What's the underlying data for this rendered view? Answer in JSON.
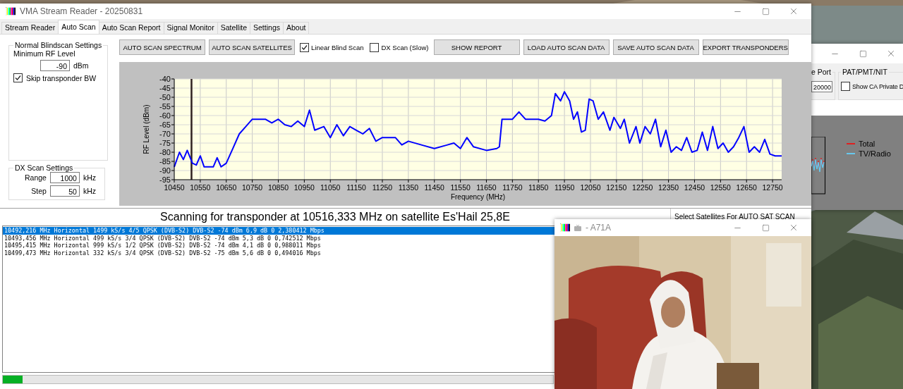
{
  "main_window": {
    "title": "VMA Stream Reader - 20250831",
    "tabs": [
      {
        "label": "Stream Reader",
        "selected": false
      },
      {
        "label": "Auto Scan",
        "selected": true
      },
      {
        "label": "Auto Scan Report",
        "selected": false
      },
      {
        "label": "Signal Monitor",
        "selected": false
      },
      {
        "label": "Satellite",
        "selected": false
      },
      {
        "label": "Settings",
        "selected": false
      },
      {
        "label": "About",
        "selected": false
      }
    ]
  },
  "blindscan_settings": {
    "title": "Normal Blindscan Settings",
    "min_rf_label": "Minimum RF Level",
    "min_rf_value": "-90",
    "min_rf_unit": "dBm",
    "skip_bw": {
      "label": "Skip transponder BW",
      "checked": true
    }
  },
  "dx_settings": {
    "title": "DX Scan Settings",
    "fields": [
      {
        "label": "Range",
        "value": "1000",
        "unit": "kHz"
      },
      {
        "label": "Step",
        "value": "50",
        "unit": "kHz"
      }
    ]
  },
  "toolbar": [
    {
      "kind": "button",
      "label": "AUTO SCAN SPECTRUM"
    },
    {
      "kind": "button",
      "label": "AUTO SCAN SATELLITES"
    },
    {
      "kind": "checkbox",
      "label": "Linear Blind Scan",
      "checked": true
    },
    {
      "kind": "checkbox",
      "label": "DX Scan (Slow)",
      "checked": false
    },
    {
      "kind": "button",
      "label": "SHOW REPORT"
    },
    {
      "kind": "button",
      "label": "LOAD AUTO SCAN DATA"
    },
    {
      "kind": "button",
      "label": "SAVE AUTO SCAN DATA"
    },
    {
      "kind": "button",
      "label": "EXPORT TRANSPONDERS"
    }
  ],
  "spectrum": {
    "chart_data": {
      "type": "line",
      "xlabel": "Frequency (MHz)",
      "ylabel": "RF Level (dBm)",
      "x": [
        10450,
        10470,
        10485,
        10500,
        10520,
        10535,
        10550,
        10565,
        10600,
        10615,
        10630,
        10650,
        10675,
        10700,
        10725,
        10750,
        10800,
        10825,
        10850,
        10875,
        10900,
        10925,
        10950,
        10970,
        10990,
        11025,
        11050,
        11075,
        11100,
        11125,
        11150,
        11175,
        11200,
        11225,
        11250,
        11300,
        11325,
        11350,
        11400,
        11450,
        11500,
        11525,
        11550,
        11575,
        11600,
        11650,
        11690,
        11700,
        11710,
        11750,
        11775,
        11800,
        11850,
        11875,
        11900,
        11915,
        11935,
        11950,
        11970,
        11985,
        12000,
        12015,
        12030,
        12045,
        12060,
        12080,
        12100,
        12125,
        12140,
        12165,
        12180,
        12200,
        12225,
        12240,
        12260,
        12280,
        12300,
        12320,
        12340,
        12360,
        12380,
        12400,
        12420,
        12440,
        12460,
        12480,
        12500,
        12520,
        12540,
        12560,
        12580,
        12600,
        12620,
        12640,
        12660,
        12680,
        12700,
        12720,
        12740,
        12760,
        12785
      ],
      "series": [
        {
          "color": "#0000ff",
          "values": [
            -88,
            -80,
            -84,
            -79,
            -86,
            -87,
            -82,
            -88,
            -88,
            -83,
            -88,
            -86,
            -78,
            -70,
            -66,
            -62,
            -62,
            -64,
            -62,
            -65,
            -66,
            -63,
            -66,
            -57,
            -68,
            -66,
            -72,
            -65,
            -71,
            -66,
            -68,
            -70,
            -67,
            -74,
            -72,
            -72,
            -76,
            -74,
            -76,
            -78,
            -76,
            -75,
            -78,
            -72,
            -77,
            -79,
            -78,
            -77,
            -62,
            -62,
            -58,
            -62,
            -62,
            -63,
            -60,
            -48,
            -52,
            -47,
            -52,
            -62,
            -58,
            -69,
            -68,
            -51,
            -52,
            -62,
            -58,
            -68,
            -61,
            -67,
            -62,
            -75,
            -66,
            -75,
            -66,
            -70,
            -62,
            -77,
            -68,
            -80,
            -77,
            -79,
            -72,
            -80,
            -79,
            -69,
            -79,
            -66,
            -78,
            -75,
            -80,
            -77,
            -72,
            -66,
            -80,
            -77,
            -80,
            -73,
            -81,
            -82,
            -82
          ]
        }
      ],
      "xlim": [
        10450,
        12785
      ],
      "ylim": [
        -95,
        -40
      ],
      "xticks": [
        10450,
        10550,
        10650,
        10750,
        10850,
        10950,
        11050,
        11150,
        11250,
        11350,
        11450,
        11550,
        11650,
        11750,
        11850,
        11950,
        12050,
        12150,
        12250,
        12350,
        12450,
        12550,
        12650,
        12750
      ],
      "yticks": [
        -40,
        -45,
        -50,
        -55,
        -60,
        -65,
        -70,
        -75,
        -80,
        -85,
        -90,
        -95
      ],
      "grid": true,
      "ref_lines": [
        {
          "axis": "x",
          "value": 10516.333
        }
      ]
    }
  },
  "status": "Scanning for transponder at 10516,333 MHz on satellite Es'Hail 25,8E",
  "satellite_panel_title": "Select Satellites For AUTO SAT SCAN",
  "transponders": [
    {
      "text": "10492,216 MHz Horizontal 1499 kS/s 4/5 QPSK (DVB-S2) DVB-S2 -74 dBm 6,9 dB 0 2,380412 Mbps",
      "selected": true
    },
    {
      "text": "10493,456 MHz Horizontal 499 kS/s 3/4 QPSK (DVB-S2) DVB-S2 -74 dBm 5,3 dB 0 0,742512 Mbps",
      "selected": false
    },
    {
      "text": "10495,415 MHz Horizontal 999 kS/s 1/2 QPSK (DVB-S2) DVB-S2 -74 dBm 4,1 dB 0 0,988011 Mbps",
      "selected": false
    },
    {
      "text": "10499,473 MHz Horizontal 332 kS/s 3/4 QPSK (DVB-S2) DVB-S2 -75 dBm 5,6 dB 0 0,494016 Mbps",
      "selected": false
    }
  ],
  "progress": {
    "level": 0.036
  },
  "back_window": {
    "port_label": "e Port",
    "port_value": "20000",
    "group_title": "PAT/PMT/NIT",
    "show_ca": {
      "label": "Show CA Private D",
      "checked": false
    },
    "legend": [
      {
        "label": "Total",
        "color": "#e02020"
      },
      {
        "label": "TV/Radio",
        "color": "#66c8ee"
      }
    ]
  },
  "video_window": {
    "title": "- A71A"
  }
}
